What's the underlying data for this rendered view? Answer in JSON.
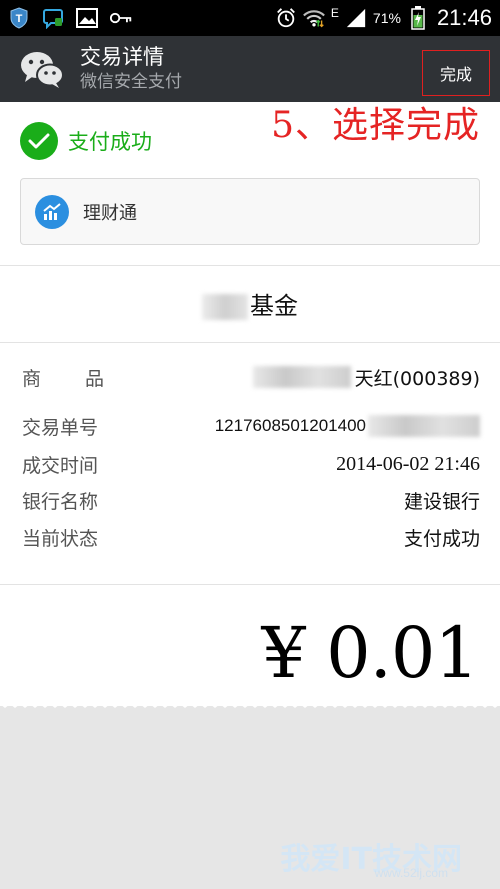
{
  "statusbar": {
    "battery_percent": "71%",
    "time": "21:46",
    "network_label": "E",
    "icons": [
      "shield-icon",
      "chat-icon",
      "image-icon",
      "key-icon",
      "alarm-icon",
      "wifi-icon",
      "signal-icon",
      "battery-icon"
    ]
  },
  "header": {
    "title": "交易详情",
    "subtitle": "微信安全支付",
    "done_label": "完成"
  },
  "annotation": "5、选择完成",
  "status": {
    "label": "支付成功"
  },
  "fund_card": {
    "label": "理财通"
  },
  "fund": {
    "name": "基金"
  },
  "details": [
    {
      "label": "商品",
      "value": "天红(000389)"
    },
    {
      "label": "交易单号",
      "value": "1217608501201400"
    },
    {
      "label": "成交时间",
      "value": "2014-06-02 21:46"
    },
    {
      "label": "银行名称",
      "value": "建设银行"
    },
    {
      "label": "当前状态",
      "value": "支付成功"
    }
  ],
  "amount": "¥ 0.01",
  "watermark": {
    "main": "我爱IT技术网",
    "sub": "www.52ij.com"
  },
  "colors": {
    "accent_green": "#1aad19",
    "annotation_red": "#e52424",
    "header_bg": "#2f3236",
    "fund_blue": "#2b8fe0"
  }
}
